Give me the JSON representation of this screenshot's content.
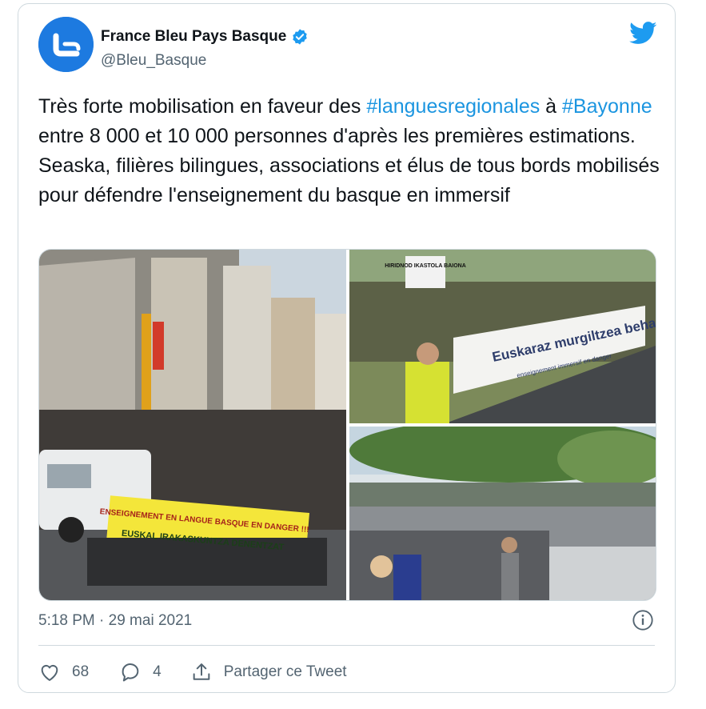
{
  "author": {
    "name": "France Bleu Pays Basque",
    "handle": "@Bleu_Basque",
    "verified": true,
    "avatar_icon": "france-bleu-logo"
  },
  "tweet": {
    "text_before_1": "Très forte mobilisation en faveur des ",
    "hashtag_1": "#languesregionales",
    "text_before_2": " à ",
    "hashtag_2": "#Bayonne",
    "text_rest": " entre 8 000 et 10 000 personnes d'après les premières estimations. Seaska, filières bilingues, associations et élus de tous bords mobilisés pour défendre l'enseignement du basque en immersif",
    "timestamp": "5:18 PM · 29 mai 2021"
  },
  "media": {
    "photos": [
      {
        "banner_1": "ENSEIGNEMENT EN LANGUE BASQUE EN DANGER !!!",
        "banner_2": "EUSKAL IRAKASKUNTZA DENENTZAT"
      },
      {
        "sign_1": "HIRIDNOD IKASTOLA BAIONA",
        "banner_1": "Euskaraz murgiltzea behar du",
        "banner_2": "enseignement immersif en danger"
      },
      {}
    ]
  },
  "actions": {
    "like_count": "68",
    "reply_count": "4",
    "share_label": "Partager ce Tweet"
  },
  "colors": {
    "hashtag": "#1b95e0",
    "brand": "#1d9bf0",
    "muted": "#536471",
    "border": "#cfd9de"
  }
}
